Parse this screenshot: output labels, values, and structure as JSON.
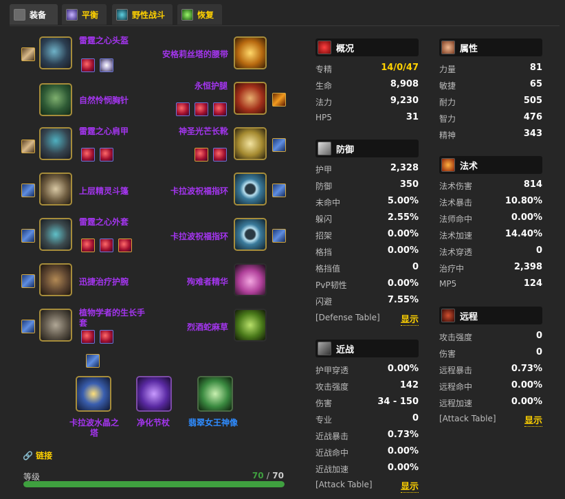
{
  "tabs": [
    {
      "label": "装备"
    },
    {
      "label": "平衡"
    },
    {
      "label": "野性战斗"
    },
    {
      "label": "恢复"
    }
  ],
  "equipment": {
    "left": [
      {
        "name": "雷霆之心头盔"
      },
      {
        "name": "自然怜悯胸针"
      },
      {
        "name": "雷霆之心肩甲"
      },
      {
        "name": "上层精灵斗篷"
      },
      {
        "name": "雷霆之心外套"
      },
      {
        "name": "迅捷治疗护腕"
      },
      {
        "name": "植物学者的生长手套"
      }
    ],
    "right": [
      {
        "name": "安格莉丝塔的腰带"
      },
      {
        "name": "永恒护腿"
      },
      {
        "name": "神圣光芒长靴"
      },
      {
        "name": "卡拉波祝福指环"
      },
      {
        "name": "卡拉波祝福指环"
      },
      {
        "name": "殉难者精华"
      },
      {
        "name": "烈酒蛇麻草"
      }
    ],
    "weapons": [
      {
        "name": "卡拉波水晶之塔"
      },
      {
        "name": "净化节杖"
      },
      {
        "name": "翡翠女王神像"
      }
    ]
  },
  "link_label": "链接",
  "level": {
    "label": "等级",
    "current": "70",
    "sep": " / ",
    "max": "70",
    "fraction": 1.0
  },
  "stats": {
    "overview": {
      "title": "概况",
      "rows": [
        {
          "label": "专精",
          "value": "14/0/47"
        },
        {
          "label": "生命",
          "value": "8,908"
        },
        {
          "label": "法力",
          "value": "9,230"
        },
        {
          "label": "HP5",
          "value": "31"
        }
      ]
    },
    "attributes": {
      "title": "属性",
      "rows": [
        {
          "label": "力量",
          "value": "81"
        },
        {
          "label": "敏捷",
          "value": "65"
        },
        {
          "label": "耐力",
          "value": "505"
        },
        {
          "label": "智力",
          "value": "476"
        },
        {
          "label": "精神",
          "value": "343"
        }
      ]
    },
    "defense": {
      "title": "防御",
      "rows": [
        {
          "label": "护甲",
          "value": "2,328"
        },
        {
          "label": "防御",
          "value": "350"
        },
        {
          "label": "未命中",
          "value": "5.00%"
        },
        {
          "label": "躲闪",
          "value": "2.55%"
        },
        {
          "label": "招架",
          "value": "0.00%"
        },
        {
          "label": "格挡",
          "value": "0.00%"
        },
        {
          "label": "格挡值",
          "value": "0"
        },
        {
          "label": "PvP韧性",
          "value": "0.00%"
        },
        {
          "label": "闪避",
          "value": "7.55%"
        }
      ],
      "table_label": "[Defense Table]",
      "show_label": "显示"
    },
    "spell": {
      "title": "法术",
      "rows": [
        {
          "label": "法术伤害",
          "value": "814"
        },
        {
          "label": "法术暴击",
          "value": "10.80%"
        },
        {
          "label": "法师命中",
          "value": "0.00%"
        },
        {
          "label": "法术加速",
          "value": "14.40%"
        },
        {
          "label": "法术穿透",
          "value": "0"
        },
        {
          "label": "治疗中",
          "value": "2,398"
        },
        {
          "label": "MP5",
          "value": "124"
        }
      ]
    },
    "melee": {
      "title": "近战",
      "rows": [
        {
          "label": "护甲穿透",
          "value": "0.00%"
        },
        {
          "label": "攻击强度",
          "value": "142"
        },
        {
          "label": "伤害",
          "value": "34 - 150"
        },
        {
          "label": "专业",
          "value": "0"
        },
        {
          "label": "近战暴击",
          "value": "0.73%"
        },
        {
          "label": "近战命中",
          "value": "0.00%"
        },
        {
          "label": "近战加速",
          "value": "0.00%"
        }
      ],
      "table_label": "[Attack Table]",
      "show_label": "显示"
    },
    "ranged": {
      "title": "远程",
      "rows": [
        {
          "label": "攻击强度",
          "value": "0"
        },
        {
          "label": "伤害",
          "value": "0"
        },
        {
          "label": "远程暴击",
          "value": "0.73%"
        },
        {
          "label": "远程命中",
          "value": "0.00%"
        },
        {
          "label": "远程加速",
          "value": "0.00%"
        }
      ],
      "table_label": "[Attack Table]",
      "show_label": "显示"
    }
  },
  "colors": {
    "epic": "#a335ee",
    "rare": "#2f8cff",
    "gold": "#ffd100",
    "progress": "#3fa03f"
  }
}
